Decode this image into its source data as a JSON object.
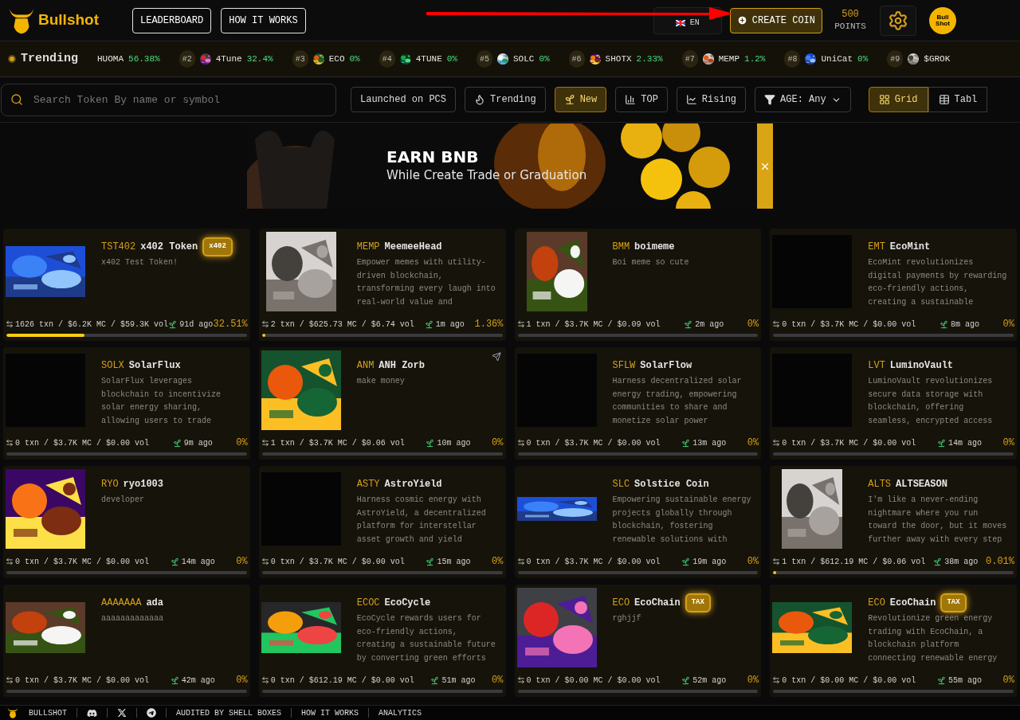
{
  "header": {
    "logo": "Bullshot",
    "nav": [
      "LEADERBOARD",
      "HOW IT WORKS"
    ],
    "language": "EN",
    "create_button": "CREATE COIN",
    "points": {
      "value": "500",
      "label": "POINTS"
    },
    "avatar": "Bull Shot"
  },
  "annotation": {
    "kind": "arrow"
  },
  "trending": {
    "label": "Trending",
    "items": [
      {
        "name": "HUOMA",
        "change": "56.38%",
        "icon": false
      },
      {
        "rank": "#2",
        "name": "4Tune",
        "change": "32.4%",
        "icon": true
      },
      {
        "rank": "#3",
        "name": "ECO",
        "change": "0%",
        "icon": true
      },
      {
        "rank": "#4",
        "name": "4TUNE",
        "change": "0%",
        "icon": true
      },
      {
        "rank": "#5",
        "name": "SOLC",
        "change": "0%",
        "icon": true
      },
      {
        "rank": "#6",
        "name": "SHOTX",
        "change": "2.33%",
        "icon": true
      },
      {
        "rank": "#7",
        "name": "MEMP",
        "change": "1.2%",
        "icon": true
      },
      {
        "rank": "#8",
        "name": "UniCat",
        "change": "0%",
        "icon": true
      },
      {
        "rank": "#9",
        "name": "$GROK",
        "icon": true
      }
    ]
  },
  "filters": {
    "search": {
      "placeholder": "Search Token By name or symbol"
    },
    "buttons": [
      {
        "kind": "plain",
        "label": "Launched on PCS",
        "selected": false
      },
      {
        "kind": "flame",
        "label": "Trending",
        "selected": false
      },
      {
        "kind": "sprout",
        "label": "New",
        "selected": true
      },
      {
        "kind": "bars",
        "label": "TOP",
        "selected": false
      },
      {
        "kind": "line",
        "label": "Rising",
        "selected": false
      },
      {
        "kind": "age",
        "label": "AGE: Any",
        "selected": false
      }
    ],
    "views": [
      {
        "kind": "grid",
        "label": "Grid",
        "selected": true
      },
      {
        "kind": "table",
        "label": "Tabl",
        "selected": false
      }
    ]
  },
  "banner": {
    "title": "EARN BNB",
    "subtitle": "While Create Trade or Graduation"
  },
  "cards": [
    {
      "ticker": "TST402",
      "name": "x402 Token",
      "badge": "x402",
      "description": "x402 Test Token!",
      "social_link": false,
      "stats": "1626 txn / $6.2K MC / $59.3K vol",
      "age": "91d ago",
      "percent": "32.51%",
      "level": 0.3251
    },
    {
      "ticker": "MEMP",
      "name": "MeemeeHead",
      "description": "Empower memes with utility-driven blockchain, transforming every laugh into real-world value and",
      "social_link": false,
      "stats": "2 txn / $625.73 MC / $6.74 vol",
      "age": "1m ago",
      "percent": "1.36%",
      "level": 0.0136
    },
    {
      "ticker": "BMM",
      "name": "boimeme",
      "description": "Boi meme so cute",
      "social_link": false,
      "stats": "1 txn / $3.7K MC / $0.09 vol",
      "age": "2m ago",
      "percent": "0%",
      "level": 0
    },
    {
      "ticker": "EMT",
      "name": "EcoMint",
      "description": "EcoMint revolutionizes digital payments by rewarding eco-friendly actions, creating a sustainable",
      "image": {
        "kind": "empty"
      },
      "social_link": false,
      "stats": "0 txn / $3.7K MC / $0.00 vol",
      "age": "8m ago",
      "percent": "0%",
      "level": 0
    },
    {
      "ticker": "SOLX",
      "name": "SolarFlux",
      "description": "SolarFlux leverages blockchain to incentivize solar energy sharing, allowing users to trade",
      "image": {
        "kind": "empty"
      },
      "social_link": false,
      "stats": "0 txn / $3.7K MC / $0.00 vol",
      "age": "9m ago",
      "percent": "0%",
      "level": 0
    },
    {
      "ticker": "ANM",
      "name": "ANH Zorb",
      "description": "make money",
      "social_link": true,
      "stats": "1 txn / $3.7K MC / $0.06 vol",
      "age": "10m ago",
      "percent": "0%",
      "level": 0
    },
    {
      "ticker": "SFLW",
      "name": "SolarFlow",
      "description": "Harness decentralized solar energy trading, empowering communities to share and monetize solar power",
      "image": {
        "kind": "empty"
      },
      "social_link": false,
      "stats": "0 txn / $3.7K MC / $0.00 vol",
      "age": "13m ago",
      "percent": "0%",
      "level": 0
    },
    {
      "ticker": "LVT",
      "name": "LuminoVault",
      "description": "LuminoVault revolutionizes secure data storage with blockchain, offering seamless, encrypted access",
      "image": {
        "kind": "empty"
      },
      "social_link": false,
      "stats": "0 txn / $3.7K MC / $0.00 vol",
      "age": "14m ago",
      "percent": "0%",
      "level": 0
    },
    {
      "ticker": "RYO",
      "name": "ryo1003",
      "description": "developer",
      "social_link": false,
      "stats": "0 txn / $3.7K MC / $0.00 vol",
      "age": "14m ago",
      "percent": "0%",
      "level": 0
    },
    {
      "ticker": "ASTY",
      "name": "AstroYield",
      "description": "Harness cosmic energy with AstroYield, a decentralized platform for interstellar asset growth and yield",
      "image": {
        "kind": "empty"
      },
      "social_link": false,
      "stats": "0 txn / $3.7K MC / $0.00 vol",
      "age": "15m ago",
      "percent": "0%",
      "level": 0
    },
    {
      "ticker": "SLC",
      "name": "Solstice Coin",
      "description": "Empowering sustainable energy projects globally through blockchain, fostering renewable solutions with",
      "social_link": false,
      "stats": "0 txn / $3.7K MC / $0.00 vol",
      "age": "19m ago",
      "percent": "0%",
      "level": 0
    },
    {
      "ticker": "ALTS",
      "name": "ALTSEASON",
      "description": "I'm like a never-ending nightmare where you run toward the door, but it moves further away with every step",
      "social_link": false,
      "stats": "1 txn / $612.19 MC / $0.06 vol",
      "age": "38m ago",
      "percent": "0.01%",
      "level": 0.0001
    },
    {
      "ticker": "AAAAAAA",
      "name": "ada",
      "description": "aaaaaaaaaaaaa",
      "social_link": false,
      "stats": "0 txn / $3.7K MC / $0.00 vol",
      "age": "42m ago",
      "percent": "0%",
      "level": 0
    },
    {
      "ticker": "ECOC",
      "name": "EcoCycle",
      "description": "EcoCycle rewards users for eco-friendly actions, creating a sustainable future by converting green efforts",
      "social_link": false,
      "stats": "0 txn / $612.19 MC / $0.00 vol",
      "age": "51m ago",
      "percent": "0%",
      "level": 0
    },
    {
      "ticker": "ECO",
      "name": "EcoChain",
      "badge": "TAX",
      "description": "rghjjf",
      "social_link": false,
      "stats": "0 txn / $0.00 MC / $0.00 vol",
      "age": "52m ago",
      "percent": "0%",
      "level": 0
    },
    {
      "ticker": "ECO",
      "name": "EcoChain",
      "badge": "TAX",
      "description": "Revolutionize green energy trading with EcoChain, a blockchain platform connecting renewable energy",
      "social_link": false,
      "stats": "0 txn / $0.00 MC / $0.00 vol",
      "age": "55m ago",
      "percent": "0%",
      "level": 0
    }
  ],
  "footer": {
    "brand": "BULLSHOT",
    "links": [
      "AUDITED BY SHELL BOXES",
      "HOW IT WORKS",
      "ANALYTICS"
    ]
  }
}
